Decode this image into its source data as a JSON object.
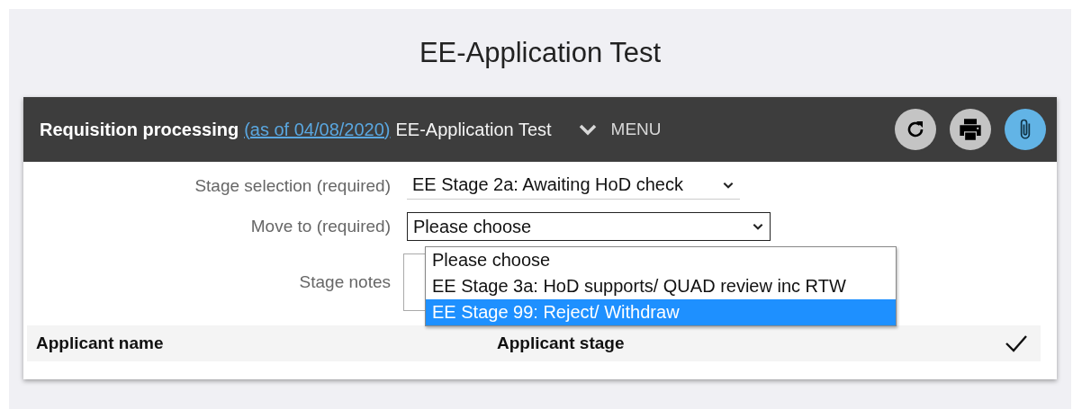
{
  "page_title": "EE-Application Test",
  "header": {
    "title": "Requisition processing",
    "date_link": "(as of 04/08/2020)",
    "subtitle": "EE-Application Test",
    "menu": "MENU"
  },
  "form": {
    "stage_selection": {
      "label": "Stage selection",
      "hint": "(required)",
      "value": "EE Stage 2a: Awaiting HoD check"
    },
    "move_to": {
      "label": "Move to",
      "hint": "(required)",
      "value": "Please choose",
      "options": [
        {
          "label": "Please choose",
          "highlighted": false
        },
        {
          "label": "EE Stage 3a: HoD supports/ QUAD review inc RTW",
          "highlighted": false
        },
        {
          "label": "EE Stage 99: Reject/ Withdraw",
          "highlighted": true
        }
      ]
    },
    "stage_notes": {
      "label": "Stage notes"
    }
  },
  "table": {
    "columns": [
      "Applicant name",
      "Applicant stage"
    ]
  }
}
